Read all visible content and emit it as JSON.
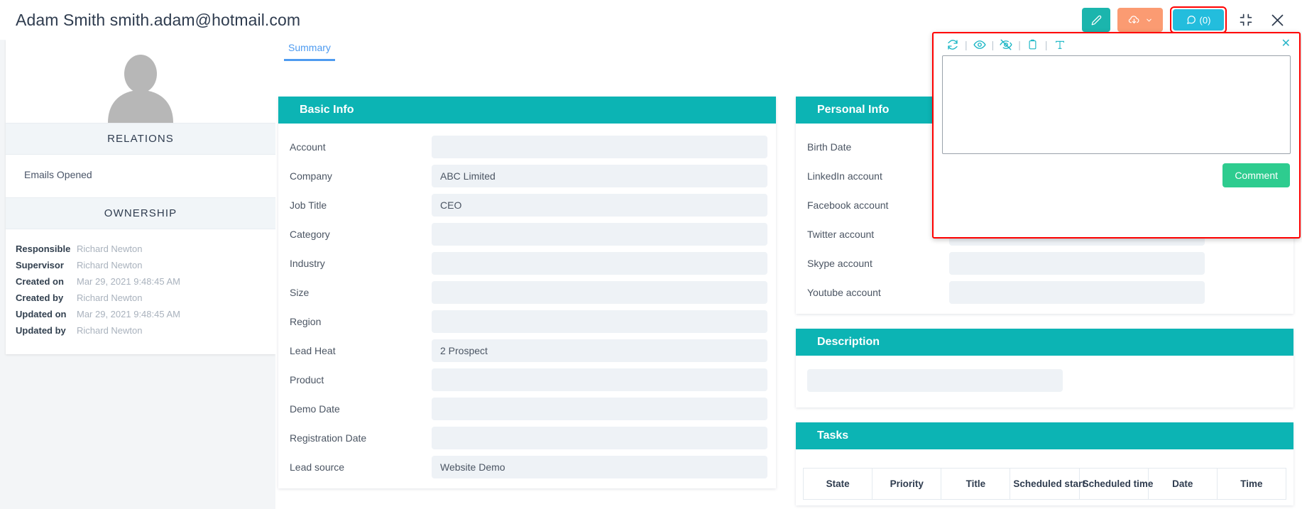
{
  "header": {
    "title": "Adam Smith smith.adam@hotmail.com",
    "actions": {
      "edit_label": "",
      "download_label": "",
      "comment_label": "(0)",
      "collapse_label": "",
      "close_label": ""
    }
  },
  "sidebar": {
    "avatar_alt": "user-avatar-placeholder",
    "relations": {
      "title": "RELATIONS",
      "items": [
        {
          "label": "Emails Opened"
        }
      ]
    },
    "ownership": {
      "title": "OWNERSHIP",
      "rows": [
        {
          "label": "Responsible",
          "value": "Richard Newton"
        },
        {
          "label": "Supervisor",
          "value": "Richard Newton"
        },
        {
          "label": "Created on",
          "value": "Mar 29, 2021 9:48:45 AM"
        },
        {
          "label": "Created by",
          "value": "Richard Newton"
        },
        {
          "label": "Updated on",
          "value": "Mar 29, 2021 9:48:45 AM"
        },
        {
          "label": "Updated by",
          "value": "Richard Newton"
        }
      ]
    }
  },
  "tabs": [
    {
      "label": "Summary",
      "active": true
    }
  ],
  "basic_info": {
    "title": "Basic Info",
    "fields": [
      {
        "label": "Account",
        "value": ""
      },
      {
        "label": "Company",
        "value": "ABC Limited"
      },
      {
        "label": "Job Title",
        "value": "CEO"
      },
      {
        "label": "Category",
        "value": ""
      },
      {
        "label": "Industry",
        "value": ""
      },
      {
        "label": "Size",
        "value": ""
      },
      {
        "label": "Region",
        "value": ""
      },
      {
        "label": "Lead Heat",
        "value": "2 Prospect"
      },
      {
        "label": "Product",
        "value": ""
      },
      {
        "label": "Demo Date",
        "value": ""
      },
      {
        "label": "Registration Date",
        "value": ""
      },
      {
        "label": "Lead source",
        "value": "Website Demo"
      }
    ]
  },
  "personal_info": {
    "title": "Personal Info",
    "fields": [
      {
        "label": "Birth Date",
        "value": ""
      },
      {
        "label": "LinkedIn account",
        "value": ""
      },
      {
        "label": "Facebook account",
        "value": ""
      },
      {
        "label": "Twitter account",
        "value": ""
      },
      {
        "label": "Skype account",
        "value": ""
      },
      {
        "label": "Youtube account",
        "value": ""
      }
    ]
  },
  "description": {
    "title": "Description",
    "value": ""
  },
  "tasks": {
    "title": "Tasks",
    "columns": [
      "State",
      "Priority",
      "Title",
      "Scheduled start",
      "Scheduled time",
      "Date",
      "Time"
    ],
    "rows": []
  },
  "comment_panel": {
    "toolbar_icons": [
      "refresh-icon",
      "eye-icon",
      "eye-slash-icon",
      "clipboard-icon",
      "text-format-icon"
    ],
    "close_label": "✕",
    "textarea_value": "",
    "textarea_placeholder": "",
    "submit_label": "Comment"
  },
  "colors": {
    "teal_header": "#0cb4b4",
    "edit_button": "#1bb5ad",
    "download_button": "#fb9b72",
    "comment_button": "#23bddd",
    "highlight_border": "#ff0000",
    "submit_green": "#2ecc8f",
    "tab_blue": "#4e9bf0",
    "field_bg": "#eef2f6"
  }
}
